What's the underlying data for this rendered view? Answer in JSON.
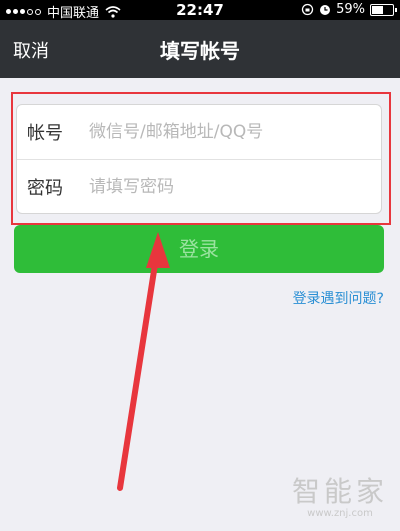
{
  "status_bar": {
    "carrier": "中国联通",
    "time": "22:47",
    "battery": "59%",
    "battery_level": 0.59,
    "icons": [
      "signal-icon",
      "wifi-icon",
      "rotation-lock-icon",
      "alarm-icon",
      "battery-icon"
    ]
  },
  "nav": {
    "cancel_label": "取消",
    "title": "填写帐号"
  },
  "form": {
    "account_label": "帐号",
    "account_placeholder": "微信号/邮箱地址/QQ号",
    "account_value": "",
    "password_label": "密码",
    "password_placeholder": "请填写密码",
    "password_value": ""
  },
  "login_button_label": "登录",
  "help_link": "登录遇到问题?",
  "watermark": {
    "logo": "智能家",
    "url": "www.znj.com"
  },
  "colors": {
    "nav_bg": "#2f3236",
    "button_green": "#2fbd39",
    "highlight_red": "#e8363d",
    "link_blue": "#2a8fd4"
  }
}
